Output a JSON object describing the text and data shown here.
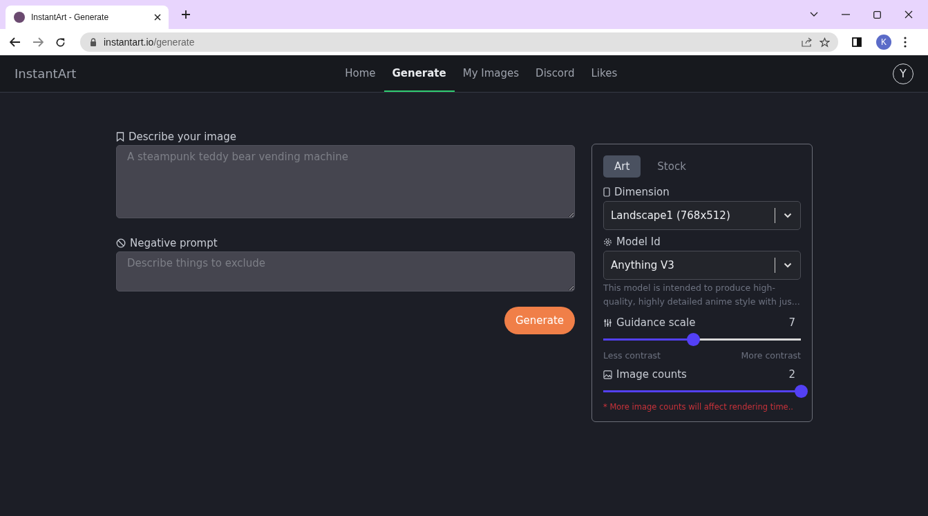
{
  "browser": {
    "tab_title": "InstantArt - Generate",
    "url_host": "instantart.io",
    "url_path": "/generate",
    "profile_initial": "K"
  },
  "navbar": {
    "brand": "InstantArt",
    "links": [
      {
        "label": "Home",
        "selected": false
      },
      {
        "label": "Generate",
        "selected": true
      },
      {
        "label": "My Images",
        "selected": false
      },
      {
        "label": "Discord",
        "selected": false
      },
      {
        "label": "Likes",
        "selected": false
      }
    ],
    "avatar": "Y"
  },
  "prompt": {
    "label": "Describe your image",
    "placeholder": "A steampunk teddy bear vending machine"
  },
  "negative_prompt": {
    "label": "Negative prompt",
    "placeholder": "Describe things to exclude"
  },
  "generate_button": "Generate",
  "settings": {
    "tabs": [
      {
        "label": "Art",
        "selected": true
      },
      {
        "label": "Stock",
        "selected": false
      }
    ],
    "dimension": {
      "label": "Dimension",
      "value": "Landscape1 (768x512)"
    },
    "model": {
      "label": "Model Id",
      "value": "Anything V3",
      "description": "This model is intended to produce high-quality, highly detailed anime style with jus..."
    },
    "guidance": {
      "label": "Guidance scale",
      "value": "7",
      "level": 0.455,
      "min_label": "Less contrast",
      "max_label": "More contrast"
    },
    "image_counts": {
      "label": "Image counts",
      "value": "2",
      "level": 1.0,
      "note": "* More image counts will affect rendering time.."
    }
  }
}
